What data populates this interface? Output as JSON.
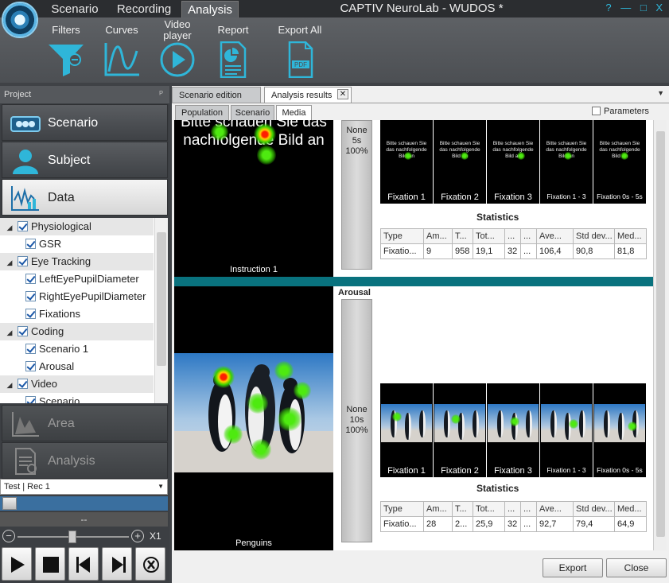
{
  "app": {
    "title": "CAPTIV NeuroLab - WUDOS *",
    "window_controls": "? — □ X"
  },
  "main_tabs": [
    {
      "label": "Scenario"
    },
    {
      "label": "Recording"
    },
    {
      "label": "Analysis"
    }
  ],
  "ribbon": {
    "filters": "Filters",
    "curves": "Curves",
    "video_player": "Video player",
    "report": "Report",
    "export_all": "Export All"
  },
  "project": {
    "header": "Project",
    "pin": "ᴾ"
  },
  "nav": {
    "scenario": "Scenario",
    "subject": "Subject",
    "data": "Data",
    "area": "Area",
    "analysis": "Analysis"
  },
  "tree": [
    {
      "label": "Physiological",
      "group": true
    },
    {
      "label": "GSR",
      "group": false
    },
    {
      "label": "Eye Tracking",
      "group": true
    },
    {
      "label": "LeftEyePupilDiameter",
      "group": false
    },
    {
      "label": "RightEyePupilDiameter",
      "group": false
    },
    {
      "label": "Fixations",
      "group": false
    },
    {
      "label": "Coding",
      "group": true
    },
    {
      "label": "Scenario 1",
      "group": false
    },
    {
      "label": "Arousal",
      "group": false
    },
    {
      "label": "Video",
      "group": true
    },
    {
      "label": "Scenario",
      "group": false
    }
  ],
  "playback": {
    "recording": "Test | Rec 1",
    "time": "--",
    "zoom": "X1",
    "zoom_minus": "−",
    "zoom_plus": "+"
  },
  "doc_tabs": {
    "scenario_edition": "Scenario edition",
    "analysis_results": "Analysis results",
    "close": "✕"
  },
  "sub_tabs": {
    "population": "Population",
    "scenario": "Scenario",
    "media": "Media",
    "parameters": "Parameters"
  },
  "sections": [
    {
      "caption": "Instruction 1",
      "title": "",
      "image_text": "Bitte schauen Sie das nachfolgende Bild an",
      "none_label": "None",
      "duration": "5s",
      "percent": "100%",
      "thumb_text": "Bitte schauen Sie das nachfolgende Bild an",
      "thumbs": [
        "Fixation 1",
        "Fixation 2",
        "Fixation 3",
        "Fixation 1 - 3",
        "Fixation 0s - 5s"
      ],
      "stats_title": "Statistics",
      "stats_header": [
        "Type",
        "Am...",
        "T...",
        "Tot...",
        "...",
        "...",
        "Ave...",
        "Std dev...",
        "Med..."
      ],
      "stats_row": [
        "Fixatio...",
        "9",
        "958",
        "19,1",
        "32",
        "...",
        "106,4",
        "90,8",
        "81,8"
      ]
    },
    {
      "caption": "Penguins",
      "title": "Arousal",
      "none_label": "None",
      "duration": "10s",
      "percent": "100%",
      "thumbs": [
        "Fixation 1",
        "Fixation 2",
        "Fixation 3",
        "Fixation 1 - 3",
        "Fixation 0s - 5s"
      ],
      "stats_title": "Statistics",
      "stats_header": [
        "Type",
        "Am...",
        "T...",
        "Tot...",
        "...",
        "...",
        "Ave...",
        "Std dev...",
        "Med..."
      ],
      "stats_row": [
        "Fixatio...",
        "28",
        "2...",
        "25,9",
        "32",
        "...",
        "92,7",
        "79,4",
        "64,9"
      ]
    }
  ],
  "buttons": {
    "export": "Export",
    "close": "Close"
  },
  "colors": {
    "accent": "#2fb6d9",
    "divider": "#09727e",
    "ribbon": "#55585c"
  }
}
